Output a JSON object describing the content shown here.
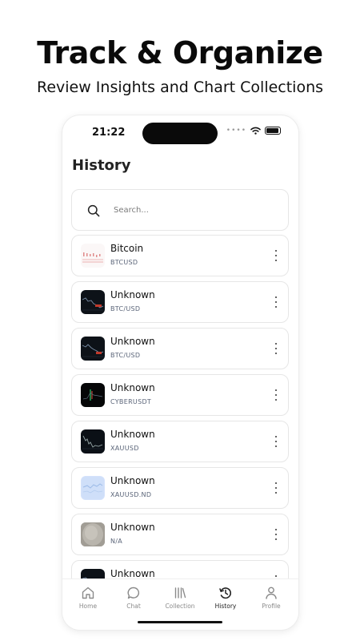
{
  "hero": {
    "title": "Track & Organize",
    "subtitle": "Review Insights and Chart Collections"
  },
  "status_bar": {
    "time": "21:22"
  },
  "screen": {
    "title": "History"
  },
  "search": {
    "placeholder": "Search..."
  },
  "history_items": [
    {
      "title": "Bitcoin",
      "symbol": "BTCUSD",
      "thumb": "light-chart"
    },
    {
      "title": "Unknown",
      "symbol": "BTC/USD",
      "thumb": "dark-chart"
    },
    {
      "title": "Unknown",
      "symbol": "BTC/USD",
      "thumb": "dark-chart"
    },
    {
      "title": "Unknown",
      "symbol": "CYBERUSDT",
      "thumb": "dark-chart"
    },
    {
      "title": "Unknown",
      "symbol": "XAUUSD",
      "thumb": "dark-chart"
    },
    {
      "title": "Unknown",
      "symbol": "XAUUSD.ND",
      "thumb": "blue-chart"
    },
    {
      "title": "Unknown",
      "symbol": "N/A",
      "thumb": "gray-photo"
    },
    {
      "title": "Unknown",
      "symbol": "",
      "thumb": "dark-chart"
    }
  ],
  "tab_bar": {
    "active": "History",
    "tabs": [
      {
        "label": "Home",
        "icon": "home-icon"
      },
      {
        "label": "Chat",
        "icon": "chat-icon"
      },
      {
        "label": "Collection",
        "icon": "collection-icon"
      },
      {
        "label": "History",
        "icon": "history-icon"
      },
      {
        "label": "Profile",
        "icon": "profile-icon"
      }
    ]
  },
  "colors": {
    "text": "#111111",
    "subtext": "#5a6478",
    "border": "#e6e6e6",
    "island": "#0a0a0a"
  }
}
